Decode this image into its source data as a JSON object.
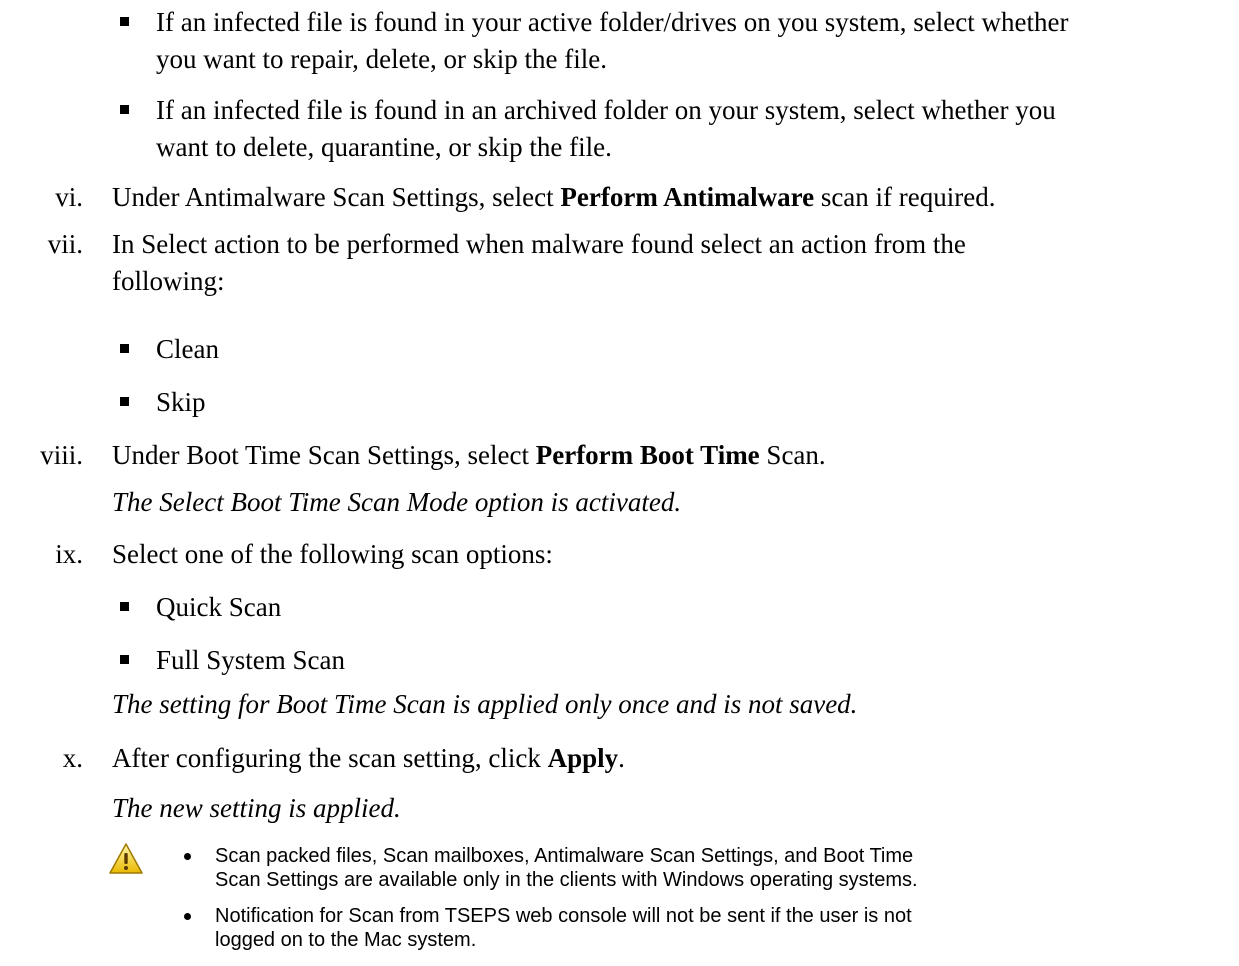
{
  "bullets_top": [
    {
      "l1": "If an infected file is found in your active folder/drives on you system, select whether",
      "l2": "you want to repair, delete, or skip the file."
    },
    {
      "l1": "If an infected file is found in an archived folder on your system, select whether you",
      "l2": "want to delete, quarantine, or skip the file."
    }
  ],
  "steps": {
    "vi": {
      "num": "vi.",
      "pre": "Under Antimalware Scan Settings, select ",
      "bold": "Perform Antimalware",
      "post": " scan if required."
    },
    "vii": {
      "num": "vii.",
      "l1": "In Select action to be performed when malware found select an action from the",
      "l2": "following:",
      "options": [
        "Clean",
        "Skip"
      ]
    },
    "viii": {
      "num": "viii.",
      "pre": "Under Boot Time Scan Settings, select ",
      "bold": "Perform Boot Time",
      "post": " Scan.",
      "note": "The Select Boot Time Scan Mode option is activated."
    },
    "ix": {
      "num": "ix.",
      "text": "Select one of the following scan options:",
      "options": [
        "Quick Scan",
        "Full System Scan"
      ],
      "note": "The setting for Boot Time Scan is applied only once and is not saved."
    },
    "x": {
      "num": "x.",
      "pre": "After configuring the scan setting, click ",
      "bold": "Apply",
      "post": ".",
      "note": "The new setting is applied."
    }
  },
  "warning": {
    "icon": "warning-icon",
    "items": [
      {
        "l1": "Scan packed files, Scan mailboxes, Antimalware Scan Settings, and Boot Time",
        "l2": "Scan Settings are available only in the clients with Windows operating systems."
      },
      {
        "l1": "Notification for Scan from TSEPS web console will not be sent if the user is not",
        "l2": "logged on to the Mac system."
      }
    ]
  }
}
